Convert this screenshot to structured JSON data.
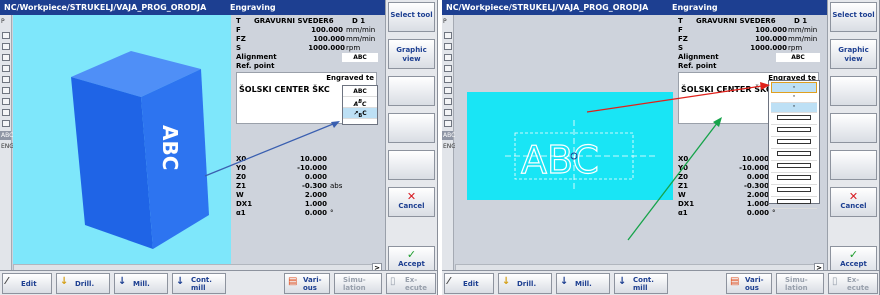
{
  "left_panel": {
    "title": "NC/Workpiece/STRUKELJ/VAJA_PROG_ORODJA",
    "section": "Engraving",
    "tool": {
      "key": "T",
      "name": "GRAVURNI SVEDER6",
      "d_label": "D",
      "d_value": "1"
    },
    "params": [
      {
        "key": "F",
        "value": "100.000",
        "unit": "mm/min"
      },
      {
        "key": "FZ",
        "value": "100.000",
        "unit": "mm/min"
      },
      {
        "key": "S",
        "value": "1000.000",
        "unit": "rpm"
      }
    ],
    "alignment_label": "Alignment",
    "alignment_value": "ABC",
    "refpoint_label": "Ref. point",
    "dropdown_items": [
      "ABC",
      "ABC (arc)",
      "ABC (slant)"
    ],
    "text_header": "Engraved te",
    "text_value": "ŠOLSKI CENTER ŠKC",
    "coords": [
      {
        "key": "X0",
        "value": "10.000",
        "unit": ""
      },
      {
        "key": "Y0",
        "value": "-10.000",
        "unit": ""
      },
      {
        "key": "Z0",
        "value": "0.000",
        "unit": ""
      },
      {
        "key": "Z1",
        "value": "-0.300",
        "unit": "abs"
      },
      {
        "key": "W",
        "value": "2.000",
        "unit": ""
      },
      {
        "key": "DX1",
        "value": "1.000",
        "unit": ""
      },
      {
        "key": "α1",
        "value": "0.000",
        "unit": "°"
      }
    ],
    "graphic_text": "ABC"
  },
  "right_panel": {
    "title": "NC/Workpiece/STRUKELJ/VAJA_PROG_ORODJA",
    "section": "Engraving",
    "tool": {
      "key": "T",
      "name": "GRAVURNI SVEDER6",
      "d_label": "D",
      "d_value": "1"
    },
    "params": [
      {
        "key": "F",
        "value": "100.000",
        "unit": "mm/min"
      },
      {
        "key": "FZ",
        "value": "100.000",
        "unit": "mm/min"
      },
      {
        "key": "S",
        "value": "1000.000",
        "unit": "rpm"
      }
    ],
    "alignment_label": "Alignment",
    "alignment_value": "ABC",
    "refpoint_label": "Ref. point",
    "text_header": "Engraved te",
    "text_value": "ŠOLSKI CENTER ŠKC",
    "coords": [
      {
        "key": "X0",
        "value": "10.000",
        "unit": ""
      },
      {
        "key": "Y0",
        "value": "-10.000",
        "unit": ""
      },
      {
        "key": "Z0",
        "value": "0.000",
        "unit": ""
      },
      {
        "key": "Z1",
        "value": "-0.300",
        "unit": "abs"
      },
      {
        "key": "W",
        "value": "2.000",
        "unit": ""
      },
      {
        "key": "DX1",
        "value": "1.000",
        "unit": ""
      },
      {
        "key": "α1",
        "value": "0.000",
        "unit": "°"
      }
    ],
    "graphic_text": "ABC"
  },
  "vertical_softkeys": {
    "select_tool": "Select tool",
    "graphic_view": "Graphic view",
    "cancel": "Cancel",
    "accept": "Accept"
  },
  "horizontal_softkeys": {
    "edit": "Edit",
    "drill": "Drill.",
    "mill": "Mill.",
    "cont_mill": "Cont. mill",
    "variants": "Vari- ous",
    "simulation": "Simu- lation",
    "execute": "Ex- ecute",
    "more": ">"
  },
  "left_bar_labels": [
    "P",
    "ABC",
    "ENG"
  ],
  "colors": {
    "title_bg": "#1d3f91",
    "graphic_bg": "#7ee7fb",
    "accent_arrow_left": "#3a5fb0",
    "accent_arrow_red": "#e0201a",
    "accent_arrow_green": "#16a34a"
  }
}
